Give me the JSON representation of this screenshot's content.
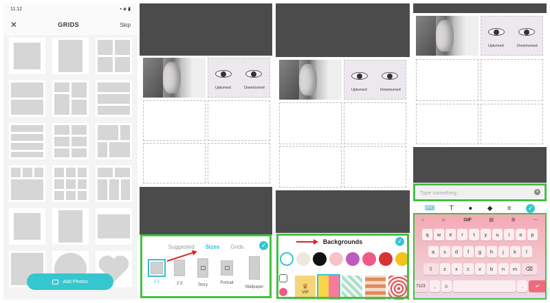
{
  "panel1": {
    "status": {
      "time": "11:12"
    },
    "header": {
      "close": "✕",
      "title": "GRIDS",
      "skip": "Skip"
    },
    "add_photos": "Add Photos"
  },
  "eyes_labels": {
    "upturned": "Upturned",
    "downturned": "Downturned"
  },
  "panel2": {
    "tabs": [
      "Suggested",
      "Sizes",
      "Grids"
    ],
    "active_tab": "Sizes",
    "sizes": [
      "1:1",
      "2:3",
      "Story",
      "Portrait",
      "Wallpaper"
    ],
    "selected_size": "1:1"
  },
  "panel3": {
    "title": "Backgrounds",
    "colors": [
      "#ffffff",
      "#efe8df",
      "#111111",
      "#f6c4c8",
      "#c05bbd",
      "#ef5b86",
      "#d83434",
      "#f4c21b"
    ],
    "vip_label": "VIP"
  },
  "panel4": {
    "input_placeholder": "Type something...",
    "keyboard": {
      "top": [
        "‹",
        "☺",
        "GIF",
        "▤",
        "⚙",
        "⋯"
      ],
      "row1": [
        "q",
        "w",
        "e",
        "r",
        "t",
        "y",
        "u",
        "i",
        "o",
        "p"
      ],
      "row2": [
        "a",
        "s",
        "d",
        "f",
        "g",
        "h",
        "j",
        "k",
        "l"
      ],
      "row3": [
        "⇧",
        "z",
        "x",
        "c",
        "v",
        "b",
        "n",
        "m",
        "⌫"
      ],
      "row4": [
        "?123",
        ",",
        "☺",
        "",
        ".",
        "↵"
      ]
    }
  },
  "colors": {
    "accent": "#35c6cf",
    "highlight": "#43c043",
    "arrow": "#d22222"
  }
}
